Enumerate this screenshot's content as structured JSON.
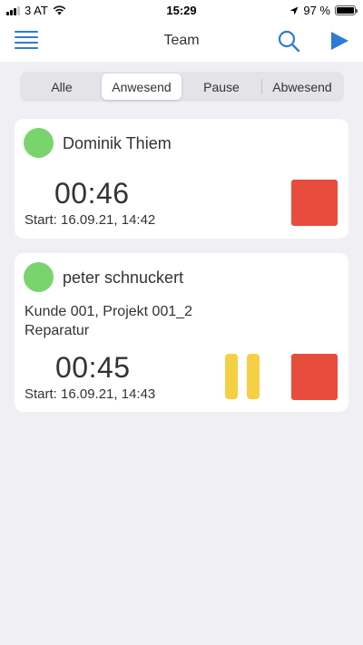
{
  "status_bar": {
    "carrier": "3 AT",
    "time": "15:29",
    "battery": "97 %"
  },
  "nav": {
    "title": "Team",
    "icons": [
      "menu-icon",
      "search-icon",
      "play-icon"
    ],
    "accent_color": "#2f7ad6"
  },
  "tabs": [
    {
      "label": "Alle",
      "active": false
    },
    {
      "label": "Anwesend",
      "active": true
    },
    {
      "label": "Pause",
      "active": false
    },
    {
      "label": "Abwesend",
      "active": false
    }
  ],
  "employees": [
    {
      "name": "Dominik Thiem",
      "status_color": "#7ad46e",
      "timer": "00:46",
      "start": "Start: 16.09.21, 14:42"
    },
    {
      "name": "peter schnuckert",
      "status_color": "#7ad46e",
      "project": "Kunde 001, Projekt 001_2",
      "activity": "Reparatur",
      "timer": "00:45",
      "start": "Start: 16.09.21, 14:43"
    }
  ],
  "colors": {
    "stop": "#e84c3d",
    "pause": "#f5d044"
  }
}
